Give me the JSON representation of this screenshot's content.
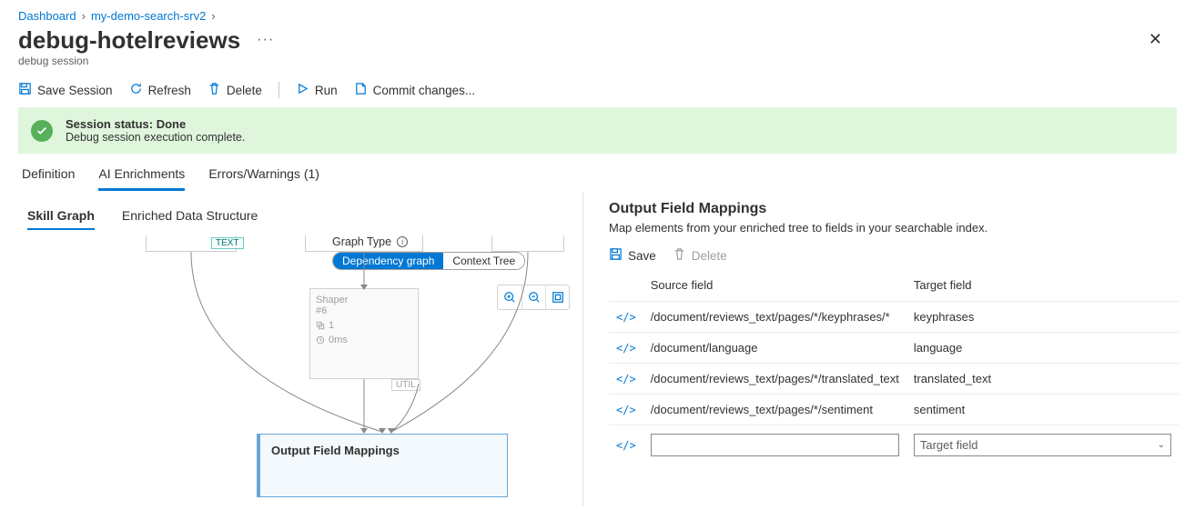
{
  "breadcrumb": {
    "items": [
      "Dashboard",
      "my-demo-search-srv2"
    ]
  },
  "title": "debug-hotelreviews",
  "subtitle": "debug session",
  "commands": {
    "save_session": "Save Session",
    "refresh": "Refresh",
    "delete": "Delete",
    "run": "Run",
    "commit": "Commit changes..."
  },
  "status": {
    "title": "Session status: Done",
    "message": "Debug session execution complete."
  },
  "tabs": {
    "definition": "Definition",
    "ai_enrichments": "AI Enrichments",
    "errors": "Errors/Warnings (1)"
  },
  "subtabs": {
    "skill_graph": "Skill Graph",
    "enriched": "Enriched Data Structure"
  },
  "graph": {
    "type_label": "Graph Type",
    "dependency": "Dependency graph",
    "context": "Context Tree",
    "text_tag": "TEXT",
    "util_tag": "UTIL",
    "shaper_name": "Shaper",
    "shaper_id": "#6",
    "shaper_instances": "1",
    "shaper_time": "0ms",
    "ofm_label": "Output Field Mappings"
  },
  "right": {
    "heading": "Output Field Mappings",
    "desc": "Map elements from your enriched tree to fields in your searchable index.",
    "save": "Save",
    "delete": "Delete",
    "col_source": "Source field",
    "col_target": "Target field",
    "rows": [
      {
        "source": "/document/reviews_text/pages/*/keyphrases/*",
        "target": "keyphrases"
      },
      {
        "source": "/document/language",
        "target": "language"
      },
      {
        "source": "/document/reviews_text/pages/*/translated_text",
        "target": "translated_text"
      },
      {
        "source": "/document/reviews_text/pages/*/sentiment",
        "target": "sentiment"
      }
    ],
    "target_placeholder": "Target field"
  }
}
